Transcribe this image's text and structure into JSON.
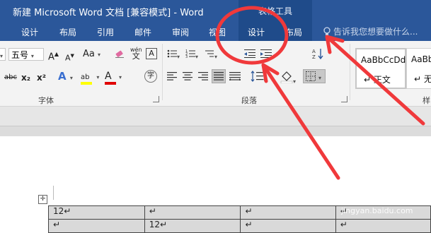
{
  "window": {
    "title": "新建 Microsoft Word 文档 [兼容模式] - Word"
  },
  "context_tab_group": {
    "label": "表格工具"
  },
  "tabs": [
    {
      "label": "设计"
    },
    {
      "label": "布局"
    },
    {
      "label": "引用"
    },
    {
      "label": "邮件"
    },
    {
      "label": "审阅"
    },
    {
      "label": "视图"
    },
    {
      "label": "设计"
    },
    {
      "label": "布局"
    }
  ],
  "tellme": {
    "placeholder": "告诉我您想要做什么..."
  },
  "ribbon": {
    "font": {
      "size_value": "五号",
      "grow_label": "A",
      "shrink_label": "A",
      "case_label": "Aa",
      "phonetic_label": "wén",
      "strike_label": "abc",
      "sub_label": "x₂",
      "sup_label": "x²",
      "effects_label": "A",
      "highlight_label": "ab",
      "color_label": "A",
      "enclose_label": "字",
      "group_label": "字体",
      "colors": {
        "highlight": "#ffff00",
        "font_color": "#e00000"
      }
    },
    "paragraph": {
      "group_label": "段落"
    },
    "styles": {
      "items": [
        {
          "sample": "AaBbCcDd",
          "name": "↵ 正文"
        },
        {
          "sample": "AaBb",
          "name": "↵ 无"
        }
      ],
      "group_label": "样"
    }
  },
  "document": {
    "table": {
      "rows": [
        [
          "12↵",
          "↵",
          "↵",
          "↵"
        ],
        [
          "↵",
          "12↵",
          "↵",
          "↵"
        ]
      ]
    }
  },
  "watermark": {
    "text": "Bai 经验",
    "url": "jingyan.baidu.com"
  },
  "colors": {
    "title_blue": "#2b579a",
    "context_blue": "#1f4b8a",
    "annotation_red": "#f0393b"
  }
}
